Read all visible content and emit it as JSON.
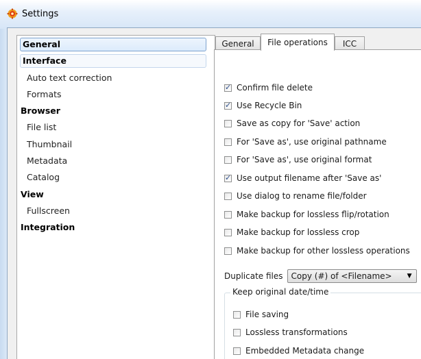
{
  "window": {
    "title": "Settings",
    "icon": "gear-app-icon"
  },
  "tree": {
    "items": [
      {
        "label": "General",
        "level": 0,
        "state": "selected"
      },
      {
        "label": "Interface",
        "level": 0,
        "state": "focused"
      },
      {
        "label": "Auto text correction",
        "level": 1
      },
      {
        "label": "Formats",
        "level": 1
      },
      {
        "label": "Browser",
        "level": 0
      },
      {
        "label": "File list",
        "level": 1
      },
      {
        "label": "Thumbnail",
        "level": 1
      },
      {
        "label": "Metadata",
        "level": 1
      },
      {
        "label": "Catalog",
        "level": 1
      },
      {
        "label": "View",
        "level": 0
      },
      {
        "label": "Fullscreen",
        "level": 1
      },
      {
        "label": "Integration",
        "level": 0
      }
    ]
  },
  "tabs": [
    {
      "label": "General",
      "active": false
    },
    {
      "label": "File operations",
      "active": true
    },
    {
      "label": "ICC",
      "active": false
    }
  ],
  "options": [
    {
      "label": "Confirm file delete",
      "checked": true
    },
    {
      "label": "Use Recycle Bin",
      "checked": true
    },
    {
      "label": "Save as copy for 'Save' action",
      "checked": false
    },
    {
      "label": "For 'Save as', use original pathname",
      "checked": false
    },
    {
      "label": "For 'Save as', use original format",
      "checked": false
    },
    {
      "label": "Use output filename after 'Save as'",
      "checked": true
    },
    {
      "label": "Use dialog to rename file/folder",
      "checked": false
    },
    {
      "label": "Make backup for lossless flip/rotation",
      "checked": false
    },
    {
      "label": "Make backup for lossless crop",
      "checked": false
    },
    {
      "label": "Make backup for other lossless operations",
      "checked": false
    }
  ],
  "duplicate_files": {
    "label": "Duplicate files",
    "selected": "Copy (#) of <Filename>"
  },
  "keep_date": {
    "title": "Keep original date/time",
    "options": [
      {
        "label": "File saving",
        "checked": false
      },
      {
        "label": "Lossless transformations",
        "checked": false
      },
      {
        "label": "Embedded Metadata change",
        "checked": false
      }
    ]
  },
  "colors": {
    "accent": "#7da2ce",
    "check": "#2b4d8a",
    "frame": "#cfe0f3"
  }
}
